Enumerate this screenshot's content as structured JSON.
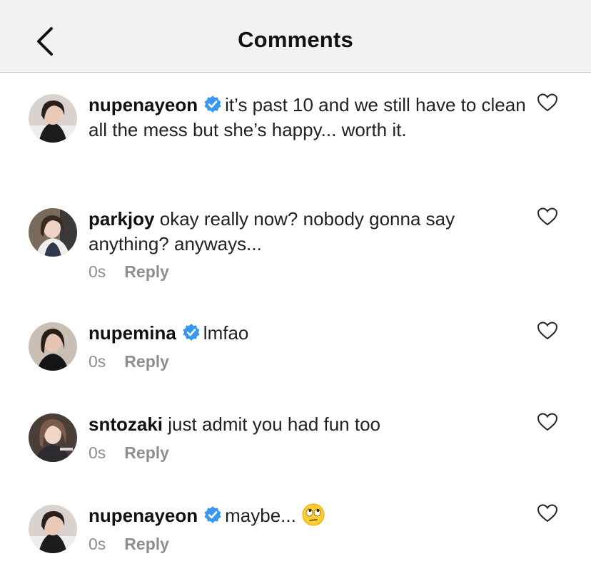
{
  "header": {
    "title": "Comments"
  },
  "comments": [
    {
      "username": "nupenayeon",
      "verified": true,
      "text": "it’s past 10 and we still have to clean all the mess but she’s happy... worth it.",
      "time": "",
      "reply": ""
    },
    {
      "username": "parkjoy",
      "verified": false,
      "text": "okay really now? nobody gonna say anything? anyways...",
      "time": "0s",
      "reply": "Reply"
    },
    {
      "username": "nupemina",
      "verified": true,
      "text": "lmfao",
      "time": "0s",
      "reply": "Reply"
    },
    {
      "username": "sntozaki",
      "verified": false,
      "text": "just admit you had fun too",
      "time": "0s",
      "reply": "Reply"
    },
    {
      "username": "nupenayeon",
      "verified": true,
      "text": "maybe...",
      "emoji": "eye-roll-emoji",
      "time": "0s",
      "reply": "Reply"
    }
  ],
  "colors": {
    "verified": "#3897f0",
    "muted": "#8e8e8e",
    "header_bg": "#f2f2f2"
  }
}
